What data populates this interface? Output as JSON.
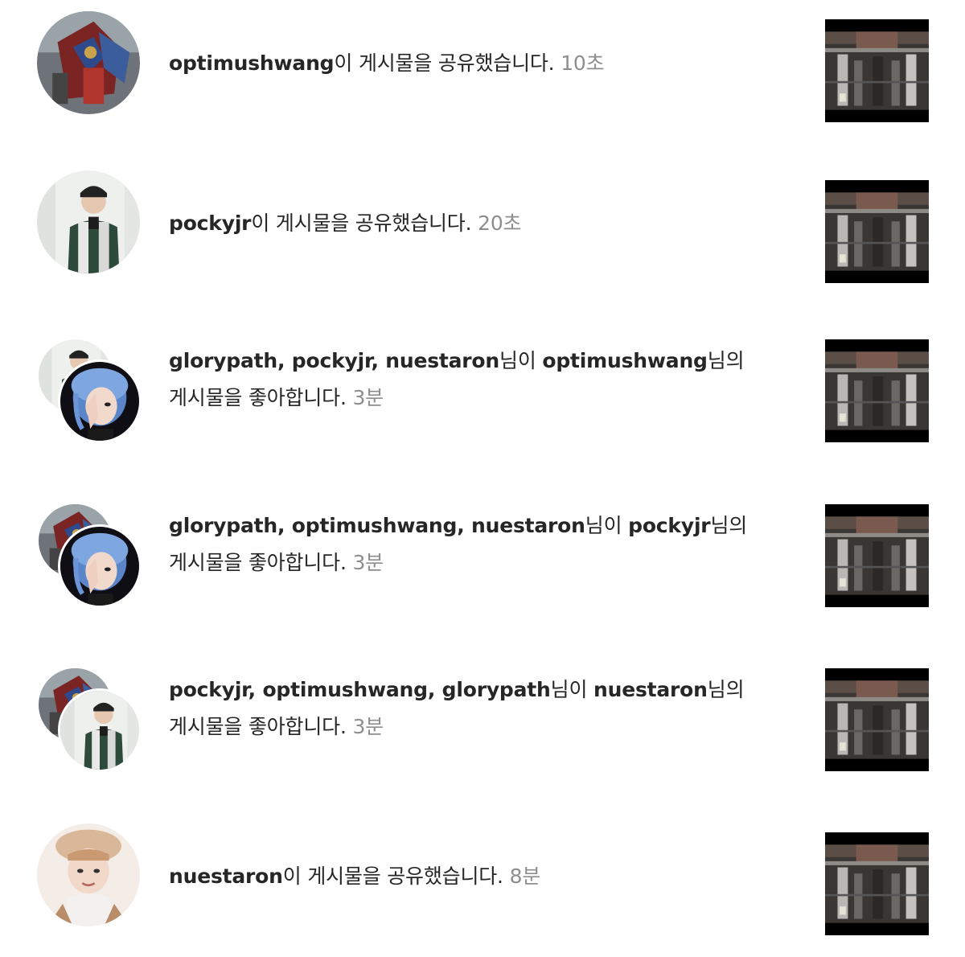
{
  "notifications": [
    {
      "type": "share",
      "users": [
        "optimushwang"
      ],
      "suffix": "이 게시물을 공유했습니다.",
      "time": "10초",
      "avatar": "transformer-avatar"
    },
    {
      "type": "share",
      "users": [
        "pockyjr"
      ],
      "suffix": "이 게시물을 공유했습니다.",
      "time": "20초",
      "avatar": "pockyjr-avatar"
    },
    {
      "type": "like",
      "likers": [
        "glorypath",
        "pockyjr",
        "nuestaron"
      ],
      "liker_suffix": "님이",
      "owner": "optimushwang",
      "owner_suffix": "님의",
      "line2": "게시물을 좋아합니다.",
      "time": "3분"
    },
    {
      "type": "like",
      "likers": [
        "glorypath",
        "optimushwang",
        "nuestaron"
      ],
      "liker_suffix": "님이",
      "owner": "pockyjr",
      "owner_suffix": "님의",
      "line2": "게시물을 좋아합니다.",
      "time": "3분"
    },
    {
      "type": "like",
      "likers": [
        "pockyjr",
        "optimushwang",
        "glorypath"
      ],
      "liker_suffix": "님이",
      "owner": "nuestaron",
      "owner_suffix": "님의",
      "line2": "게시물을 좋아합니다.",
      "time": "3분"
    },
    {
      "type": "share",
      "users": [
        "nuestaron"
      ],
      "suffix": "이 게시물을 공유했습니다.",
      "time": "8분",
      "avatar": "nuestaron-avatar"
    }
  ],
  "separator": ", ",
  "colors": {
    "text": "#262626",
    "time": "#8e8e8e",
    "background": "#ffffff"
  }
}
